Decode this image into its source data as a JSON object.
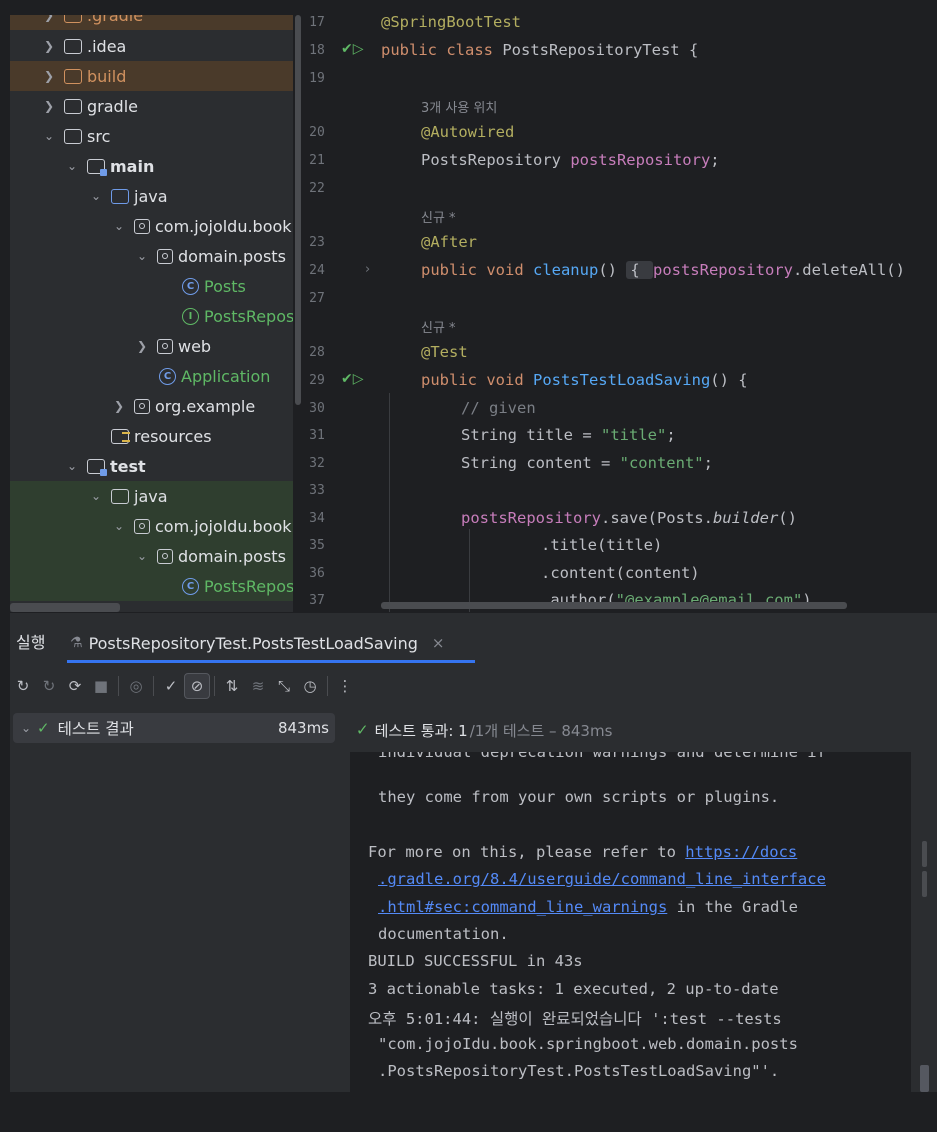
{
  "tree": {
    "items": [
      {
        "label": ".gradle",
        "icon": "folder-icon"
      },
      {
        "label": ".idea",
        "icon": "folder-icon"
      },
      {
        "label": "build",
        "icon": "folder-icon"
      },
      {
        "label": "gradle",
        "icon": "folder-icon"
      },
      {
        "label": "src",
        "icon": "folder-icon"
      },
      {
        "label": "main",
        "icon": "module-folder-icon"
      },
      {
        "label": "java",
        "icon": "source-folder-icon"
      },
      {
        "label": "com.jojoldu.book",
        "icon": "package-icon"
      },
      {
        "label": "domain.posts",
        "icon": "package-icon"
      },
      {
        "label": "Posts",
        "icon": "class-icon",
        "glyph": "C"
      },
      {
        "label": "PostsRepos",
        "icon": "interface-icon",
        "glyph": "I"
      },
      {
        "label": "web",
        "icon": "package-icon"
      },
      {
        "label": "Application",
        "icon": "class-icon",
        "glyph": "C"
      },
      {
        "label": "org.example",
        "icon": "package-icon"
      },
      {
        "label": "resources",
        "icon": "resources-folder-icon"
      },
      {
        "label": "test",
        "icon": "module-folder-icon"
      },
      {
        "label": "java",
        "icon": "test-source-folder-icon"
      },
      {
        "label": "com.jojoldu.book",
        "icon": "package-icon"
      },
      {
        "label": "domain.posts",
        "icon": "package-icon"
      },
      {
        "label": "PostsRepos",
        "icon": "class-icon",
        "glyph": "C"
      }
    ]
  },
  "editor": {
    "line_numbers": [
      "17",
      "18",
      "19",
      "20",
      "21",
      "22",
      "23",
      "24",
      "27",
      "28",
      "29",
      "30",
      "31",
      "32",
      "33",
      "34",
      "35",
      "36",
      "37"
    ],
    "hints": {
      "usages": "3개 사용 위치",
      "new1": "신규 *",
      "new2": "신규 *"
    },
    "code": {
      "l17_ann": "@SpringBootTest",
      "l18_kw": "public class ",
      "l18_name": "PostsRepositoryTest {",
      "l20_ann": "@Autowired",
      "l21_type": "PostsRepository ",
      "l21_field": "postsRepository",
      "l21_end": ";",
      "l23_ann": "@After",
      "l24_kw": "public void ",
      "l24_fn": "cleanup",
      "l24_paren": "() ",
      "l24_fold": "{ ",
      "l24_field": "postsRepository",
      "l24_end": ".deleteAll()",
      "l28_ann": "@Test",
      "l29_kw": "public void ",
      "l29_fn": "PostsTestLoadSaving",
      "l29_end": "() {",
      "l30_cmt": "// given",
      "l31_a": "String title = ",
      "l31_str": "\"title\"",
      "l31_end": ";",
      "l32_a": "String content = ",
      "l32_str": "\"content\"",
      "l32_end": ";",
      "l34_field": "postsRepository",
      "l34_mid": ".save(Posts.",
      "l34_it": "builder",
      "l34_end": "()",
      "l35": ".title(title)",
      "l36": ".content(content)",
      "l37_a": ".author(",
      "l37_str": "\"@example@email.com\"",
      "l37_end": ")"
    }
  },
  "run": {
    "title": "실행",
    "tab_label": "PostsRepositoryTest.PostsTestLoadSaving",
    "close_icon": "×",
    "toolbar": [
      "rerun-icon",
      "rerun-failed-icon",
      "toggle-auto-test-icon",
      "stop-icon",
      "show-passed-icon",
      "show-ignored-icon",
      "sort-icon",
      "collapse-icon",
      "import-icon",
      "history-icon",
      "more-icon"
    ],
    "tests": {
      "root_label": "테스트 결과",
      "duration": "843ms"
    },
    "summary": {
      "passed": "테스트 통과: 1",
      "total": " /1개 테스트 – 843ms"
    },
    "console": {
      "l1": "individual deprecation warnings and determine if",
      "l2": "they come from your own scripts or plugins.",
      "l3_a": "For more on this, please refer to ",
      "l3_link": "https://docs",
      "l4_link": ".gradle.org/8.4/userguide/command_line_interface",
      "l5_link": ".html#sec:command_line_warnings",
      "l5_b": " in the Gradle",
      "l6": "documentation.",
      "l7": "BUILD SUCCESSFUL in 43s",
      "l8": "3 actionable tasks: 1 executed, 2 up-to-date",
      "l9": "오후 5:01:44: 실행이 완료되었습니다 ':test --tests",
      "l10": "\"com.jojoIdu.book.springboot.web.domain.posts",
      "l11": ".PostsRepositoryTest.PostsTestLoadSaving\"'."
    }
  },
  "colors": {
    "background": "#1e1f22",
    "panel": "#2b2d30",
    "accent": "#3574f0",
    "success": "#5fb865",
    "annotation": "#b3ae60",
    "keyword": "#cf8e6d",
    "function": "#56a8f5",
    "field": "#c77dbb",
    "string": "#6aab73",
    "link": "#548af7"
  }
}
